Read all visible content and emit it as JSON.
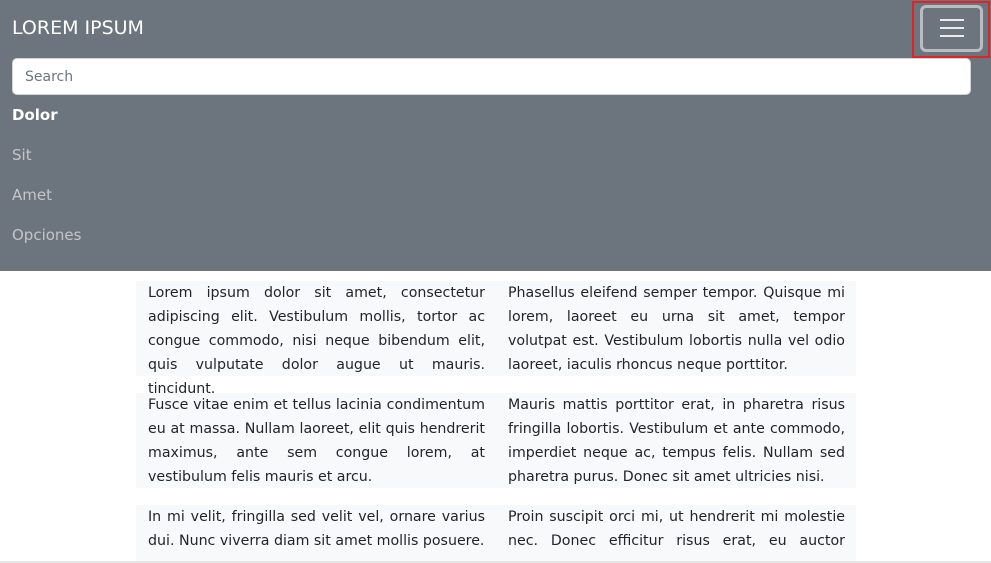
{
  "navbar": {
    "brand": "LOREM IPSUM",
    "toggler_icon": "hamburger-menu-icon",
    "search_placeholder": "Search",
    "search_value": "",
    "items": [
      {
        "label": "Dolor",
        "active": true
      },
      {
        "label": "Sit",
        "active": false
      },
      {
        "label": "Amet",
        "active": false
      },
      {
        "label": "Opciones",
        "active": false
      }
    ]
  },
  "content": {
    "rows": [
      {
        "left": "Lorem ipsum dolor sit amet, consectetur adipiscing elit. Vestibulum mollis, tortor ac congue commodo, nisi neque bibendum elit, quis vulputate dolor augue ut mauris. tincidunt.",
        "right": "Phasellus eleifend semper tempor. Quisque mi lorem, laoreet eu urna sit amet, tempor volutpat est. Vestibulum lobortis nulla vel odio laoreet, iaculis rhoncus neque porttitor."
      },
      {
        "left": "Fusce vitae enim et tellus lacinia condimentum eu at massa. Nullam laoreet, elit quis hendrerit maximus, ante sem congue lorem, at vestibulum felis mauris et arcu.",
        "right": "Mauris mattis porttitor erat, in pharetra risus fringilla lobortis. Vestibulum et ante commodo, imperdiet neque ac, tempus felis. Nullam sed pharetra purus. Donec sit amet ultricies nisi."
      },
      {
        "left": "In mi velit, fringilla sed velit vel, ornare varius dui. Nunc viverra diam sit amet mollis posuere.",
        "right": "Proin suscipit orci mi, ut hendrerit mi molestie nec. Donec efficitur risus erat, eu auctor massa"
      }
    ]
  },
  "colors": {
    "navbar_bg": "#6c757d",
    "row_bg": "#f8f9fa",
    "highlight": "#e02424"
  }
}
